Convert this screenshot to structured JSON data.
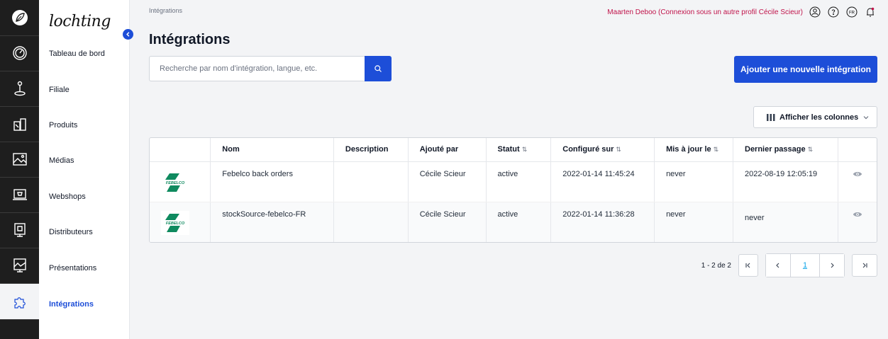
{
  "app": {
    "logo_text": "lochting"
  },
  "breadcrumb": "Intégrations",
  "header": {
    "impersonation_text": "Maarten Deboo (Connexion sous un autre profil Cécile Scieur)",
    "language": "FR"
  },
  "nav": {
    "items": [
      {
        "label": "Tableau de bord",
        "icon": "dashboard-icon"
      },
      {
        "label": "Filiale",
        "icon": "branch-icon"
      },
      {
        "label": "Produits",
        "icon": "products-icon"
      },
      {
        "label": "Médias",
        "icon": "media-icon"
      },
      {
        "label": "Webshops",
        "icon": "webshop-icon"
      },
      {
        "label": "Distributeurs",
        "icon": "distributor-icon"
      },
      {
        "label": "Présentations",
        "icon": "presentation-icon"
      },
      {
        "label": "Intégrations",
        "icon": "puzzle-icon",
        "active": true
      }
    ]
  },
  "page": {
    "title": "Intégrations",
    "search_placeholder": "Recherche par nom d'intégration, langue, etc.",
    "add_button": "Ajouter une nouvelle intégration",
    "columns_button": "Afficher les colonnes"
  },
  "table": {
    "headers": {
      "name": "Nom",
      "description": "Description",
      "added_by": "Ajouté par",
      "status": "Statut",
      "configured": "Configuré sur",
      "updated": "Mis à jour le",
      "last_run": "Dernier passage"
    },
    "rows": [
      {
        "logo_text": "FEBELCO",
        "name": "Febelco back orders",
        "description": "",
        "added_by": "Cécile Scieur",
        "status": "active",
        "configured": "2022-01-14 11:45:24",
        "updated": "never",
        "last_run": "2022-08-19 12:05:19"
      },
      {
        "logo_text": "FEBELCO",
        "name": "stockSource-febelco-FR",
        "description": "",
        "added_by": "Cécile Scieur",
        "status": "active",
        "configured": "2022-01-14 11:36:28",
        "updated": "never",
        "last_run": "never"
      }
    ]
  },
  "pagination": {
    "info": "1 - 2 de 2",
    "current_page": "1"
  },
  "colors": {
    "primary": "#1d4ed8",
    "impersonation": "#c0134a",
    "febelco_green": "#0f8a5f",
    "rail_bg": "#1e1e1e"
  }
}
